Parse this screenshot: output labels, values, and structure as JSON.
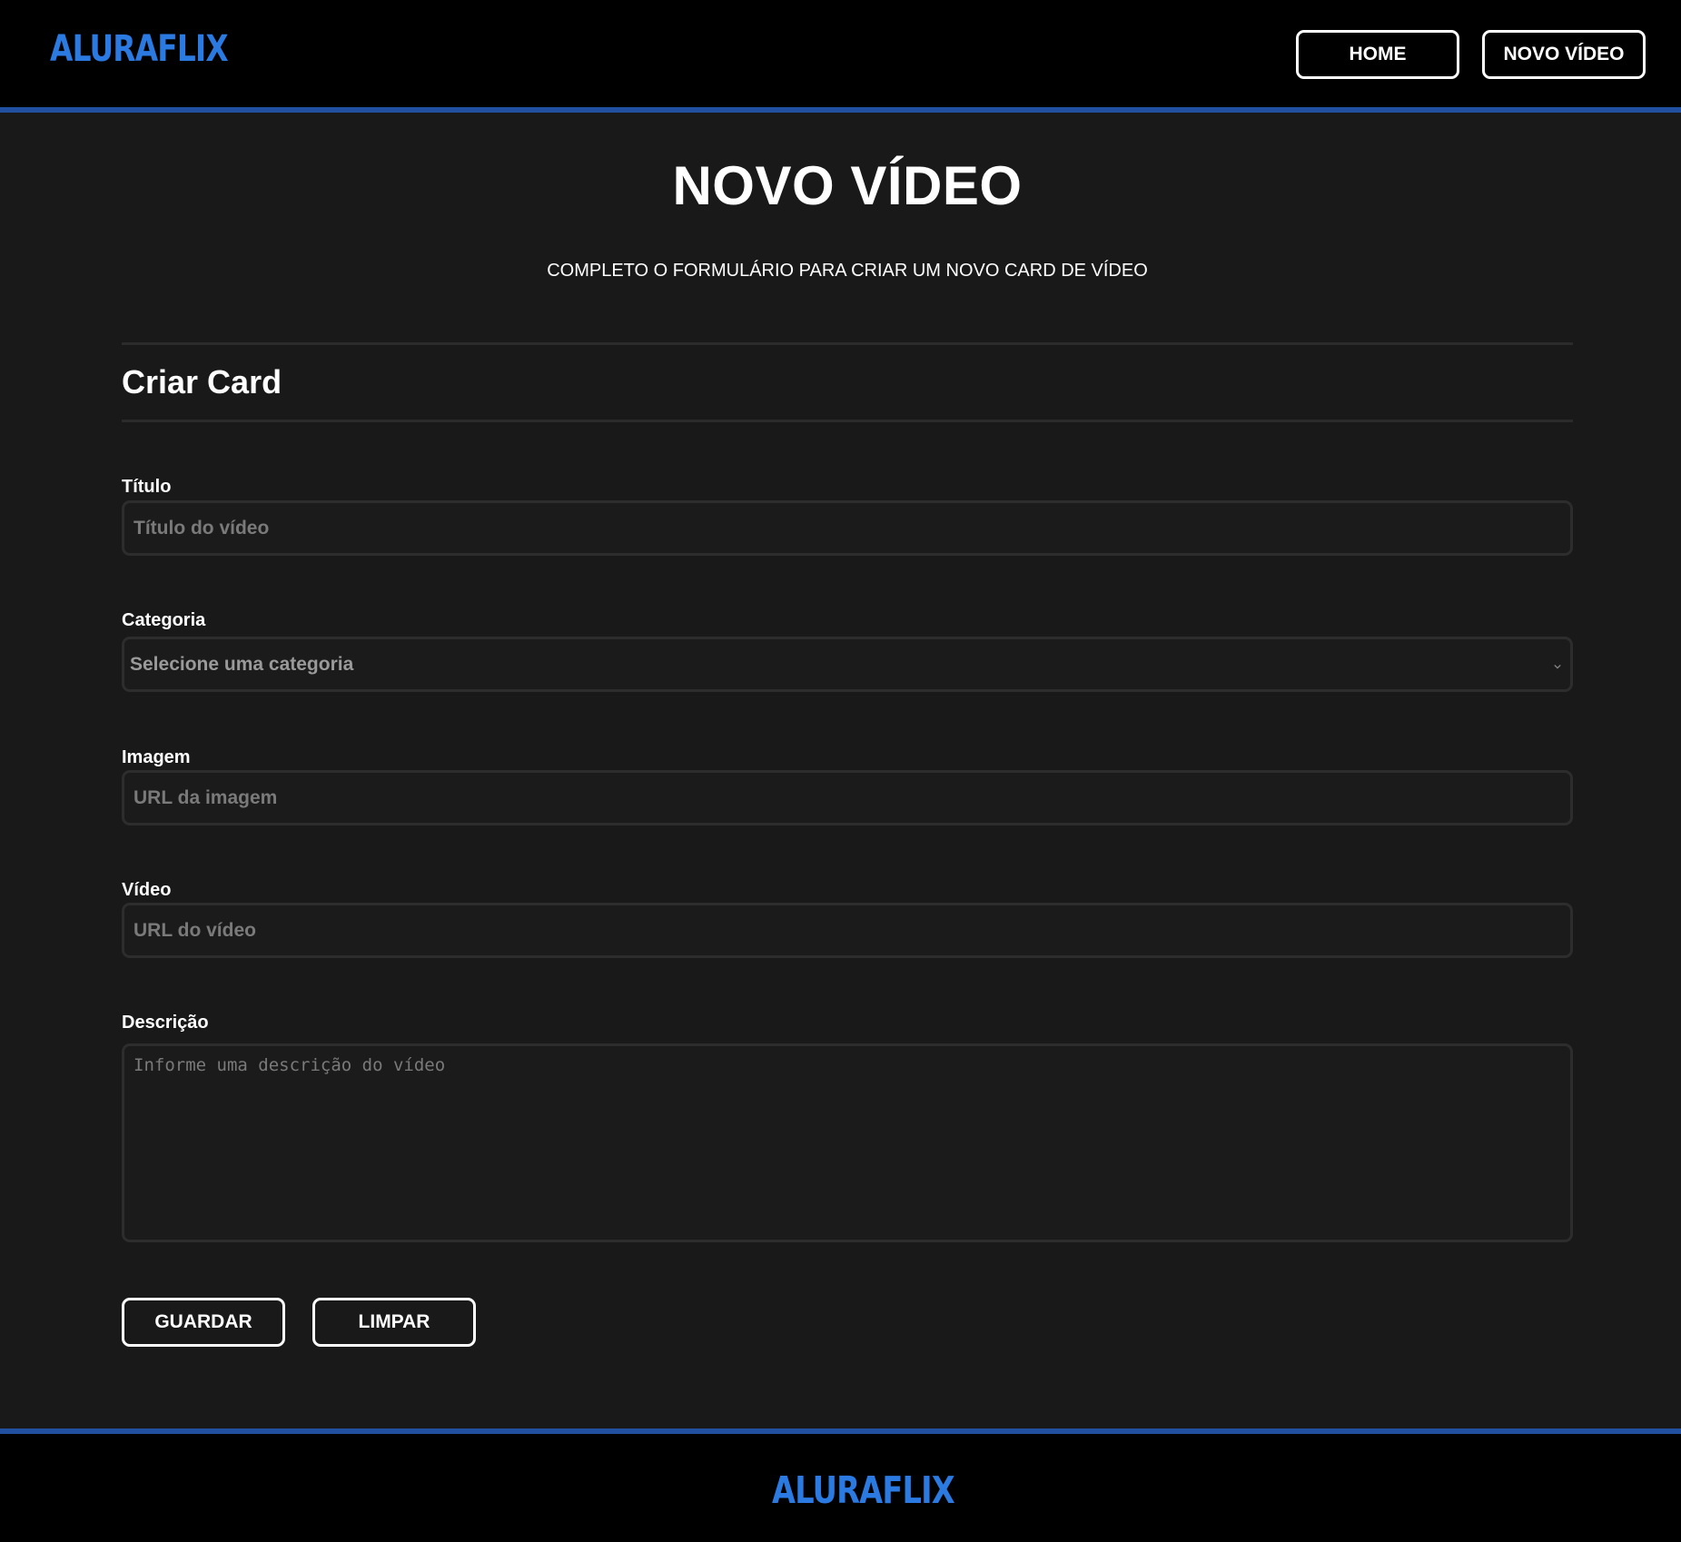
{
  "header": {
    "logo": "ALURAFLIX",
    "nav": {
      "home_label": "HOME",
      "new_video_label": "NOVO VÍDEO"
    }
  },
  "main": {
    "title": "NOVO VÍDEO",
    "subtitle": "COMPLETO O FORMULÁRIO PARA CRIAR UM NOVO CARD DE VÍDEO",
    "section_title": "Criar Card",
    "fields": {
      "title": {
        "label": "Título",
        "placeholder": "Título do vídeo",
        "value": ""
      },
      "category": {
        "label": "Categoria",
        "selected": "Selecione uma categoria"
      },
      "image": {
        "label": "Imagem",
        "placeholder": "URL da imagem",
        "value": ""
      },
      "video": {
        "label": "Vídeo",
        "placeholder": "URL do vídeo",
        "value": ""
      },
      "description": {
        "label": "Descrição",
        "placeholder": "Informe uma descrição do vídeo",
        "value": ""
      }
    },
    "buttons": {
      "save_label": "GUARDAR",
      "clear_label": "LIMPAR"
    }
  },
  "footer": {
    "logo": "ALURAFLIX"
  },
  "icons": {
    "select_chevron": "chevron-down-icon"
  },
  "colors": {
    "accent": "#2a7ae2",
    "accent_border": "#2250a0",
    "background": "#191919",
    "bar_background": "#000000",
    "text": "#ffffff"
  }
}
